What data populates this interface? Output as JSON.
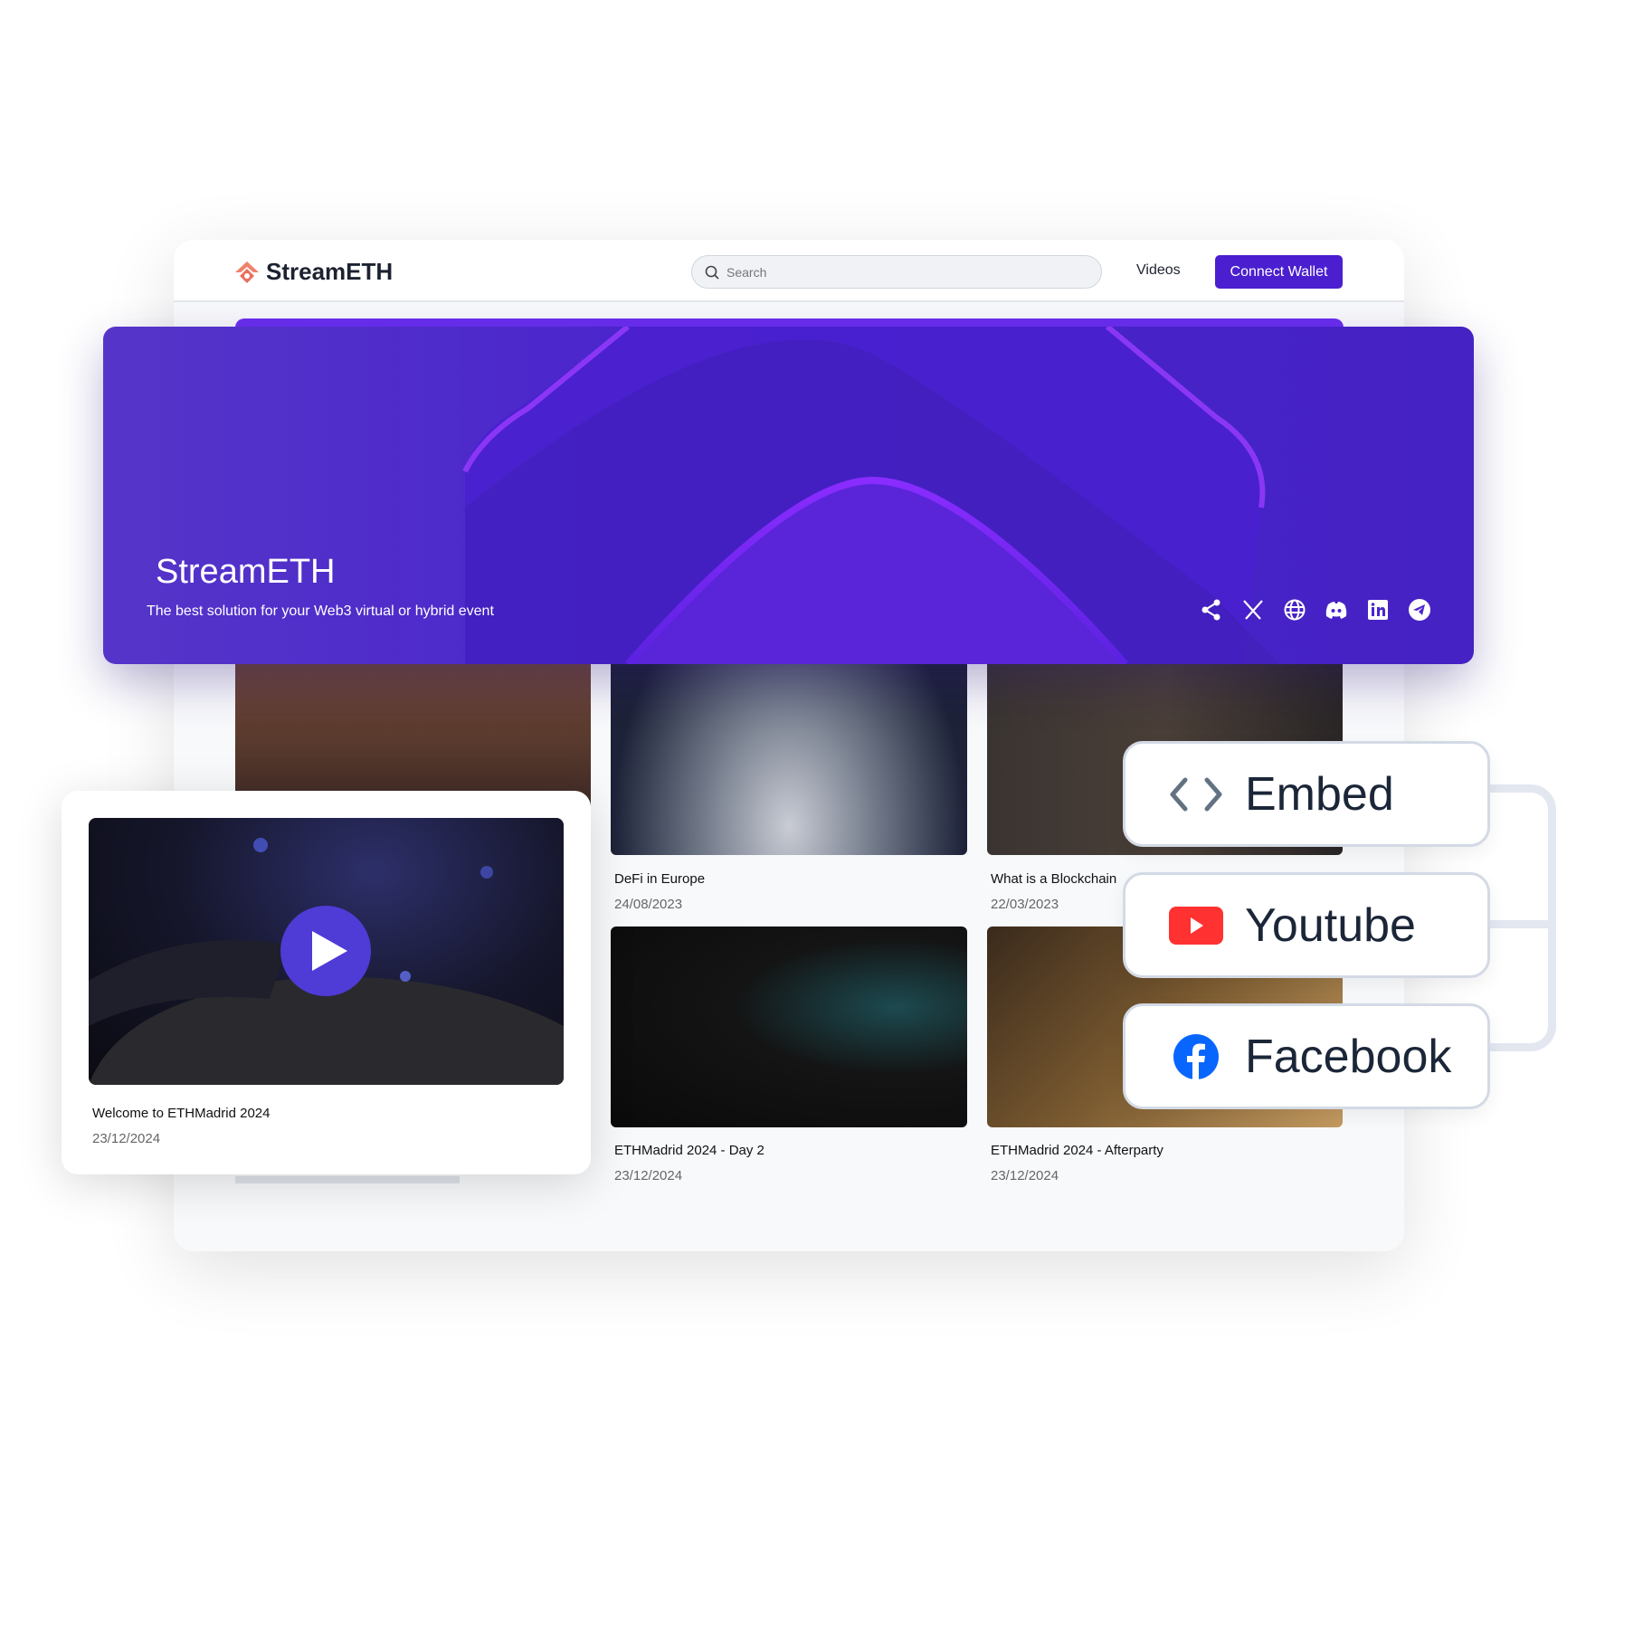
{
  "header": {
    "logo_text": "StreamETH",
    "search_placeholder": "Search",
    "videos_link": "Videos",
    "connect_wallet": "Connect Wallet"
  },
  "banner": {
    "title": "StreamETH",
    "subtitle": "The best solution for your Web3 virtual or hybrid event",
    "social_icons": [
      "share-icon",
      "x-icon",
      "globe-icon",
      "discord-icon",
      "linkedin-icon",
      "telegram-icon"
    ]
  },
  "videos": [
    {
      "title": "DeFi in Europe",
      "date": "24/08/2023"
    },
    {
      "title": "What is a Blockchain",
      "date": "22/03/2023"
    },
    {
      "title": "ETHMadrid 2024 - Day 2",
      "date": "23/12/2024"
    },
    {
      "title": "ETHMadrid 2024 - Afterparty",
      "date": "23/12/2024"
    }
  ],
  "featured": {
    "title": "Welcome to ETHMadrid 2024",
    "date": "23/12/2024"
  },
  "share_options": [
    {
      "label": "Embed",
      "icon": "code-icon"
    },
    {
      "label": "Youtube",
      "icon": "youtube-icon",
      "color": "#ff3131"
    },
    {
      "label": "Facebook",
      "icon": "facebook-icon",
      "color": "#0866ff"
    }
  ],
  "colors": {
    "brand": "#4b1fcf",
    "banner": "#4a25cc"
  }
}
